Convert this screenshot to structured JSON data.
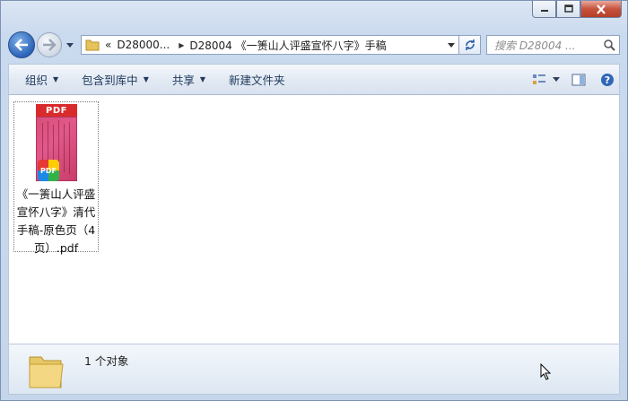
{
  "window": {
    "caption_buttons": [
      "minimize-icon",
      "maximize-icon",
      "close-icon"
    ]
  },
  "nav": {
    "back_icon": "back-arrow-icon",
    "forward_icon": "forward-arrow-icon"
  },
  "address": {
    "overflow": "«",
    "segment1": "D28000...",
    "segment2": "D28004 《一箦山人评盛宣怀八字》手稿"
  },
  "search": {
    "placeholder": "搜索 D28004 ..."
  },
  "toolbar": {
    "organize": "组织",
    "include_library": "包含到库中",
    "share": "共享",
    "new_folder": "新建文件夹"
  },
  "files": [
    {
      "name": "《一箦山人评盛宣怀八字》清代手稿-原色页（4页）.pdf",
      "thumb_label": "PDF",
      "badge_label": "PDF"
    }
  ],
  "status": {
    "count_text": "1 个对象"
  },
  "colors": {
    "accent": "#1e395b",
    "pdf_red": "#d92b2b",
    "close_red": "#c7533d"
  }
}
